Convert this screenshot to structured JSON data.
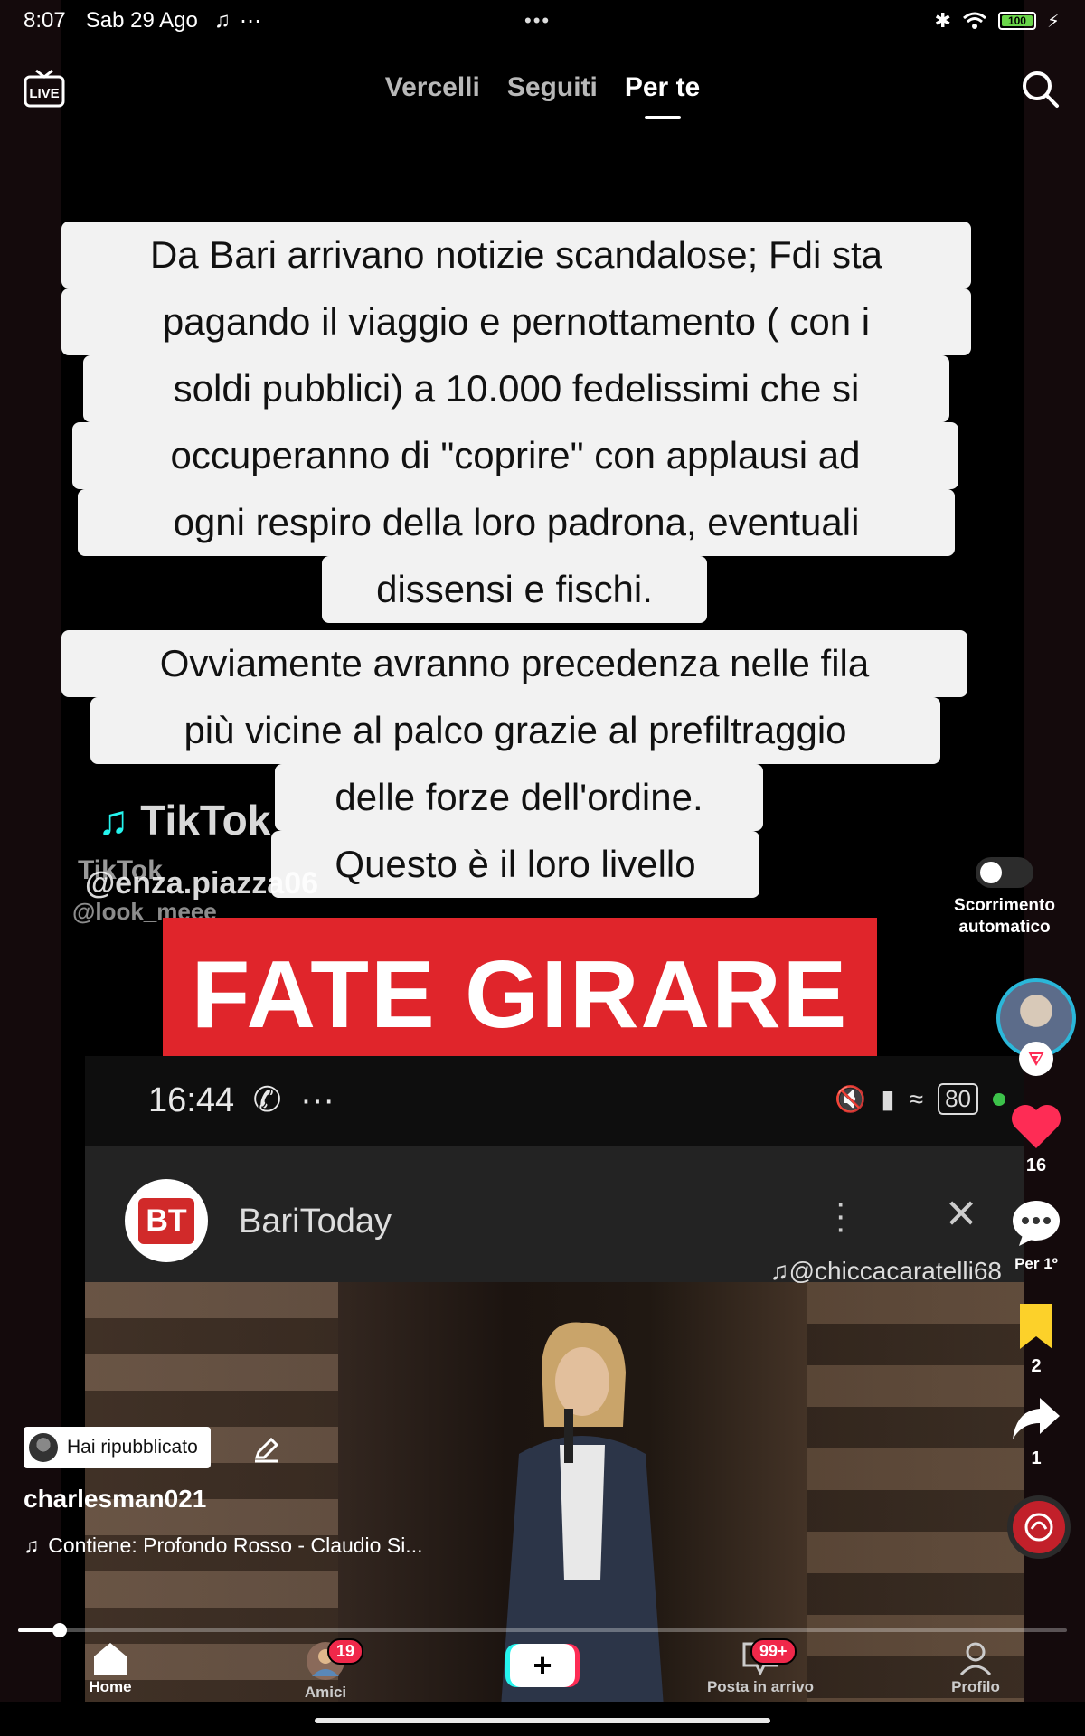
{
  "status_bar": {
    "time": "8:07",
    "date": "Sab 29 Ago",
    "more": "⋯",
    "center_dots": "•••",
    "battery": "100"
  },
  "top_nav": {
    "live_label": "LIVE",
    "tabs": [
      "Vercelli",
      "Seguiti",
      "Per te"
    ],
    "active_tab": "Per te"
  },
  "video": {
    "caption_lines": [
      "Da Bari arrivano notizie scandalose; Fdi sta",
      "pagando il viaggio e pernottamento ( con i",
      "soldi pubblici) a 10.000 fedelissimi che si",
      "occuperanno di \"coprire\" con applausi ad",
      "ogni respiro della loro padrona, eventuali",
      "dissensi e fischi.",
      "Ovviamente avranno precedenza nelle fila",
      "più vicine al palco grazie al prefiltraggio",
      "delle forze dell'ordine.",
      "Questo è il loro livello"
    ],
    "watermark_1_logo": "TikTok",
    "watermark_1_handle": "@enza.piazza06",
    "watermark_2_logo": "TikTok",
    "watermark_2_handle": "@look_meee",
    "banner": "FATE GIRARE",
    "inner": {
      "time": "16:44",
      "battery": "80",
      "app_logo": "BT",
      "app_name": "BariToday",
      "handle": "@chiccacaratelli68"
    }
  },
  "side_actions": {
    "autoscroll_label": "Scorrimento automatico",
    "likes": "16",
    "comments": "Per 1º",
    "saves": "2",
    "shares": "1"
  },
  "post_info": {
    "repost_label": "Hai ripubblicato",
    "username": "charlesman021",
    "music": "Contiene: Profondo Rosso - Claudio Si..."
  },
  "playback": {
    "progress": 0.04
  },
  "bottom_nav": {
    "home": "Home",
    "friends": "Amici",
    "friends_badge": "19",
    "create": "+",
    "inbox": "Posta in arrivo",
    "inbox_badge": "99+",
    "profile": "Profilo"
  },
  "colors": {
    "like": "#fe2c55",
    "save": "#fcd12a",
    "banner": "#e0252b",
    "avatar_ring": "#2ab7d9",
    "badge": "#f0284a"
  }
}
